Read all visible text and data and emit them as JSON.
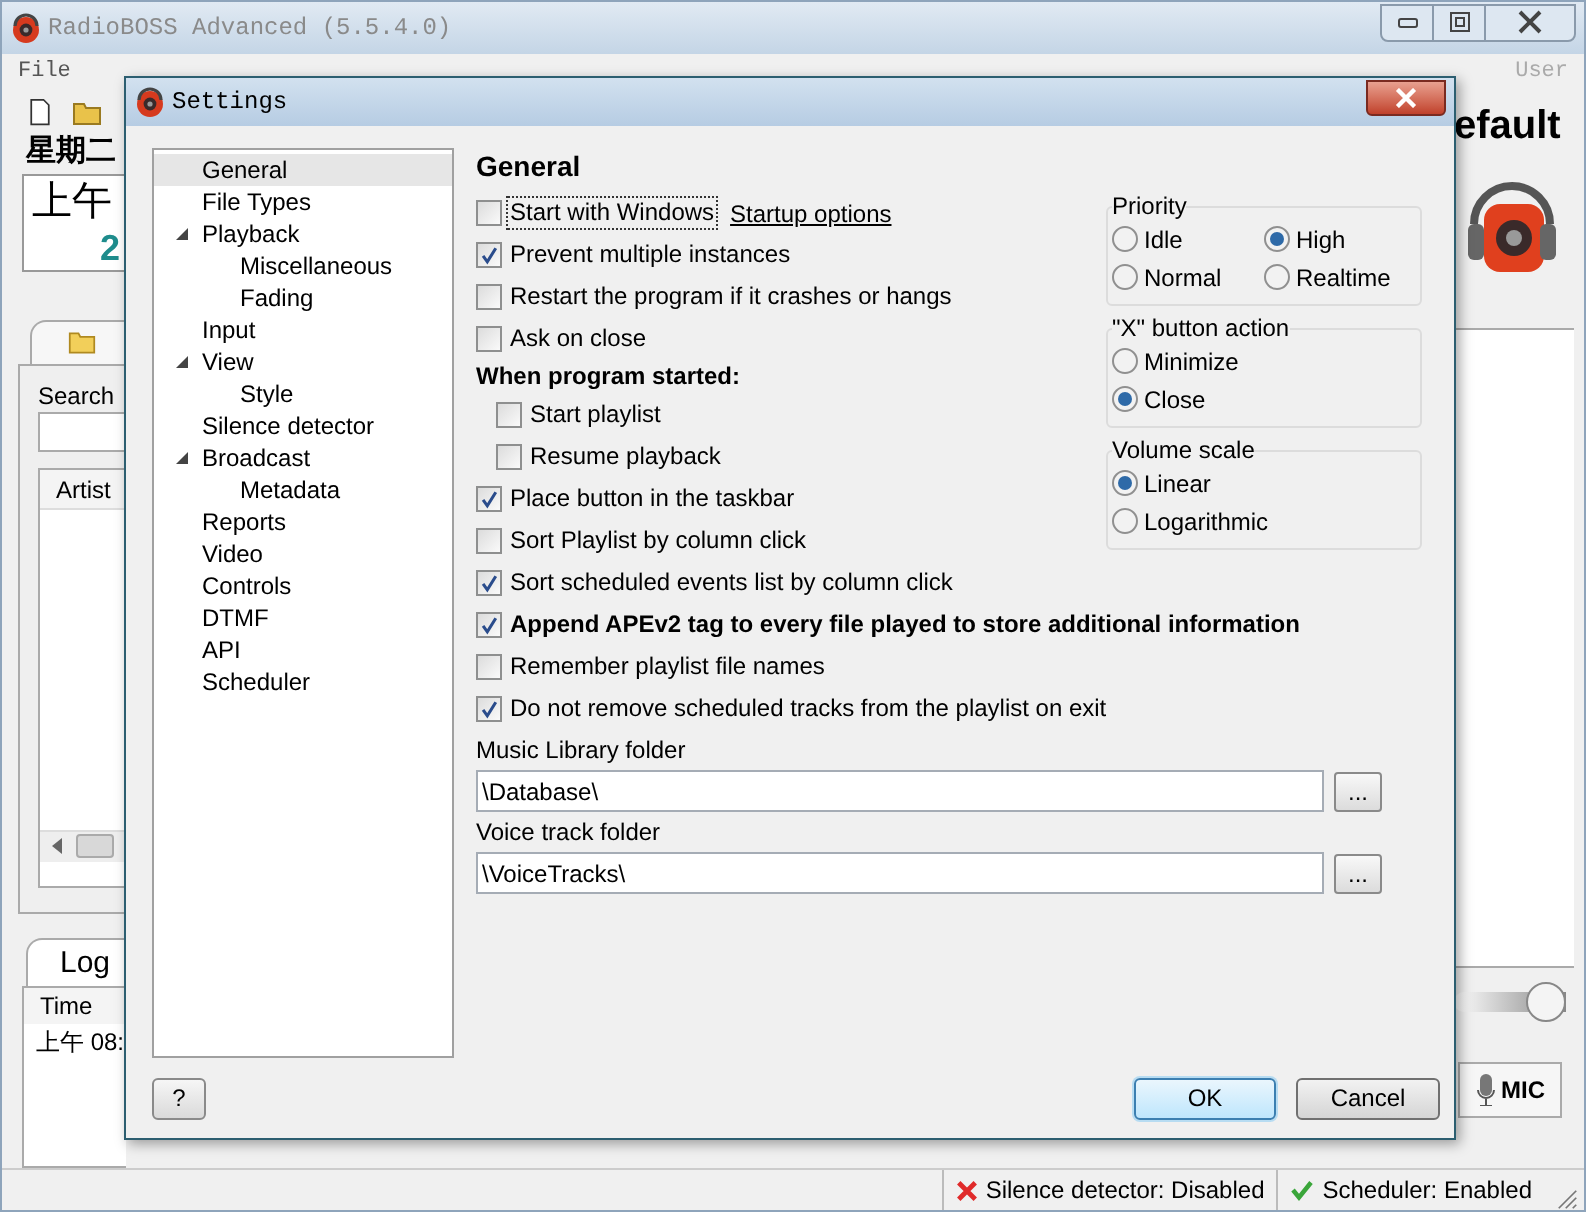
{
  "main_window": {
    "title": "RadioBOSS Advanced (5.5.4.0)",
    "menu": [
      "File"
    ],
    "user_label": "User",
    "day": "星期二",
    "clock": "上午",
    "volume": {
      "level": 1
    },
    "clock_date": "2",
    "profile": "efault",
    "search_label": "Search",
    "list_column": "Artist",
    "log_tab": "Log",
    "log_column": "Time",
    "log_row": "上午 08:",
    "mic_button": "MIC",
    "status_bar": [
      {
        "text": "Silence detector: Disabled",
        "kind": "error"
      },
      {
        "text": "Scheduler: Enabled",
        "kind": "ok"
      }
    ]
  },
  "dialog": {
    "title": "Settings",
    "tree": [
      {
        "label": "General",
        "selected": true
      },
      {
        "label": "File Types",
        "selected": false
      },
      {
        "label": "Playback",
        "selected": false,
        "expanded": true,
        "children": [
          {
            "label": "Miscellaneous",
            "selected": false
          },
          {
            "label": "Fading",
            "selected": false
          }
        ]
      },
      {
        "label": "Input",
        "selected": false
      },
      {
        "label": "View",
        "selected": false,
        "expanded": true,
        "children": [
          {
            "label": "Style",
            "selected": false
          }
        ]
      },
      {
        "label": "Silence detector",
        "selected": false
      },
      {
        "label": "Broadcast",
        "selected": false,
        "expanded": true,
        "children": [
          {
            "label": "Metadata",
            "selected": false
          }
        ]
      },
      {
        "label": "Reports",
        "selected": false
      },
      {
        "label": "Video",
        "selected": false
      },
      {
        "label": "Controls",
        "selected": false
      },
      {
        "label": "DTMF",
        "selected": false
      },
      {
        "label": "API",
        "selected": false
      },
      {
        "label": "Scheduler",
        "selected": false
      }
    ],
    "heading": "General",
    "options": [
      {
        "kind": "checkbox",
        "label": "Start with Windows",
        "checked": false,
        "focused": true,
        "link": "Startup options"
      },
      {
        "kind": "checkbox",
        "label": "Prevent multiple instances",
        "checked": true
      },
      {
        "kind": "checkbox",
        "label": "Restart the program if it crashes or hangs",
        "checked": false
      },
      {
        "kind": "checkbox",
        "label": "Ask on close",
        "checked": false
      },
      {
        "kind": "heading",
        "label": "When program started:",
        "children": [
          {
            "kind": "checkbox",
            "label": "Start playlist",
            "checked": false
          },
          {
            "kind": "checkbox",
            "label": "Resume playback",
            "checked": false
          }
        ]
      },
      {
        "kind": "checkbox",
        "label": "Place button in the taskbar",
        "checked": true
      },
      {
        "kind": "checkbox",
        "label": "Sort Playlist by column click",
        "checked": false
      },
      {
        "kind": "checkbox",
        "label": "Sort scheduled events list by column click",
        "checked": true
      },
      {
        "kind": "checkbox",
        "label": "Append APEv2 tag to every file played to store additional information",
        "checked": true,
        "emphasis": true
      },
      {
        "kind": "checkbox",
        "label": "Remember playlist file names",
        "checked": false
      },
      {
        "kind": "checkbox",
        "label": "Do not remove scheduled tracks from the playlist on exit",
        "checked": true
      }
    ],
    "groups": [
      {
        "title": "Priority",
        "options": [
          {
            "label": "Idle",
            "selected": false
          },
          {
            "label": "High",
            "selected": true
          },
          {
            "label": "Normal",
            "selected": false
          },
          {
            "label": "Realtime",
            "selected": false
          }
        ]
      },
      {
        "title": "\"X\" button action",
        "options": [
          {
            "label": "Minimize",
            "selected": false
          },
          {
            "label": "Close",
            "selected": true
          }
        ]
      },
      {
        "title": "Volume scale",
        "options": [
          {
            "label": "Linear",
            "selected": true
          },
          {
            "label": "Logarithmic",
            "selected": false
          }
        ]
      }
    ],
    "folders": [
      {
        "label": "Music Library folder",
        "value": "\\Database\\",
        "browse": "..."
      },
      {
        "label": "Voice track folder",
        "value": "\\VoiceTracks\\",
        "browse": "..."
      }
    ],
    "help_button": "?",
    "ok_button": "OK",
    "cancel_button": "Cancel"
  }
}
